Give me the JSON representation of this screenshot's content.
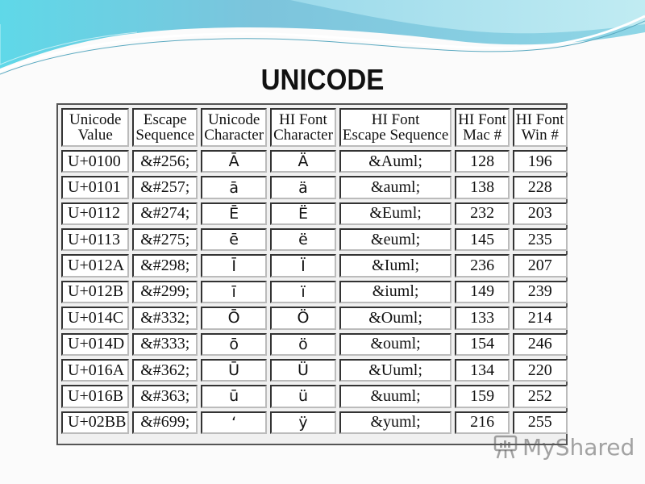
{
  "slide": {
    "title": "UNICODE"
  },
  "table": {
    "headers": [
      [
        "Unicode",
        "Value"
      ],
      [
        "Escape",
        "Sequence"
      ],
      [
        "Unicode",
        "Character"
      ],
      [
        "HI Font",
        "Character"
      ],
      [
        "HI Font",
        "Escape Sequence"
      ],
      [
        "HI Font",
        "Mac #"
      ],
      [
        "HI Font",
        "Win #"
      ]
    ],
    "rows": [
      [
        "U+0100",
        "&#256;",
        "Ā",
        "Ä",
        "&Auml;",
        "128",
        "196"
      ],
      [
        "U+0101",
        "&#257;",
        "ā",
        "ä",
        "&auml;",
        "138",
        "228"
      ],
      [
        "U+0112",
        "&#274;",
        "Ē",
        "Ë",
        "&Euml;",
        "232",
        "203"
      ],
      [
        "U+0113",
        "&#275;",
        "ē",
        "ë",
        "&euml;",
        "145",
        "235"
      ],
      [
        "U+012A",
        "&#298;",
        "Ī",
        "Ï",
        "&Iuml;",
        "236",
        "207"
      ],
      [
        "U+012B",
        "&#299;",
        "ī",
        "ï",
        "&iuml;",
        "149",
        "239"
      ],
      [
        "U+014C",
        "&#332;",
        "Ō",
        "Ö",
        "&Ouml;",
        "133",
        "214"
      ],
      [
        "U+014D",
        "&#333;",
        "ō",
        "ö",
        "&ouml;",
        "154",
        "246"
      ],
      [
        "U+016A",
        "&#362;",
        "Ū",
        "Ü",
        "&Uuml;",
        "134",
        "220"
      ],
      [
        "U+016B",
        "&#363;",
        "ū",
        "ü",
        "&uuml;",
        "159",
        "252"
      ],
      [
        "U+02BB",
        "&#699;",
        "ʻ",
        "ÿ",
        "&yuml;",
        "216",
        "255"
      ]
    ]
  },
  "watermark": {
    "text": "MyShared",
    "icon": "presentation-board-icon"
  },
  "colors": {
    "wave_dark": "#6fb8d6",
    "wave_light": "#7fe3ee",
    "title": "#111111"
  }
}
